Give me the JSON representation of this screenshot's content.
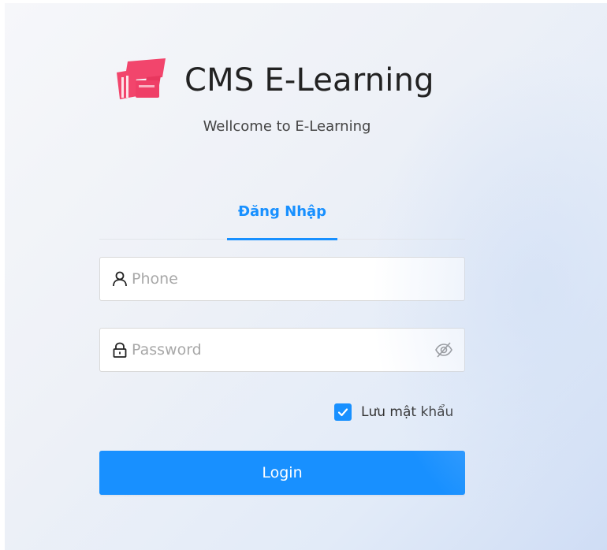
{
  "brand": {
    "title": "CMS E-Learning",
    "subtitle": "Wellcome to E-Learning",
    "logo_icon": "graduation-cap-icon",
    "logo_color": "#f2456c"
  },
  "tabs": [
    {
      "label": "Đăng Nhập",
      "active": true
    }
  ],
  "form": {
    "phone": {
      "placeholder": "Phone",
      "value": "",
      "icon": "user-icon"
    },
    "password": {
      "placeholder": "Password",
      "value": "",
      "icon": "lock-icon",
      "toggle_icon": "eye-invisible-icon"
    },
    "remember": {
      "label": "Lưu mật khẩu",
      "checked": true
    },
    "submit_label": "Login"
  },
  "colors": {
    "primary": "#1890ff",
    "text": "#222222",
    "placeholder": "#a8a8a8"
  }
}
